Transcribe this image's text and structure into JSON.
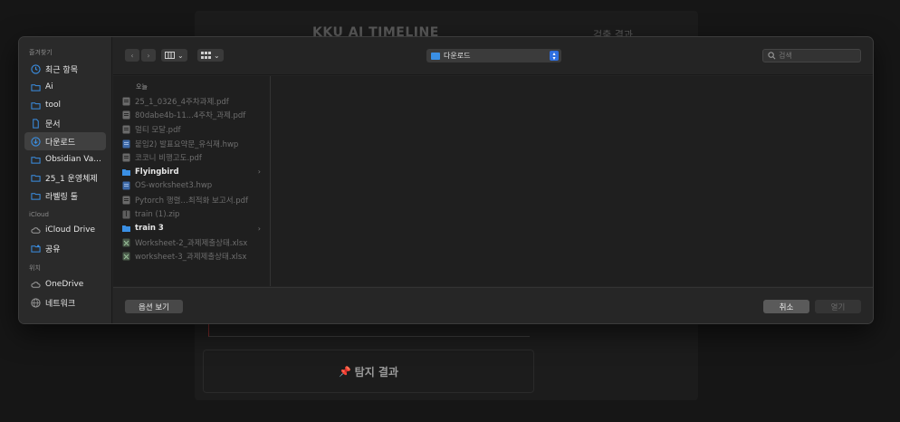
{
  "background": {
    "title": "KKU AI TIMELINE",
    "right_title": "검출 결과",
    "result_label": "탐지 결과",
    "result_icon": "pin-icon"
  },
  "sidebar": {
    "favorites_label": "즐겨찾기",
    "favorites": [
      {
        "label": "최근 항목",
        "icon": "clock-icon"
      },
      {
        "label": "Ai",
        "icon": "folder-icon"
      },
      {
        "label": "tool",
        "icon": "folder-icon"
      },
      {
        "label": "문서",
        "icon": "document-icon"
      },
      {
        "label": "다운로드",
        "icon": "download-icon",
        "active": true
      },
      {
        "label": "Obsidian Va...",
        "icon": "folder-icon"
      },
      {
        "label": "25_1 운영체제",
        "icon": "folder-icon"
      },
      {
        "label": "라벨링 툴",
        "icon": "folder-icon"
      }
    ],
    "icloud_label": "iCloud",
    "icloud": [
      {
        "label": "iCloud Drive",
        "icon": "cloud-icon"
      },
      {
        "label": "공유",
        "icon": "shared-folder-icon"
      }
    ],
    "locations_label": "위치",
    "locations": [
      {
        "label": "OneDrive",
        "icon": "cloud-icon"
      },
      {
        "label": "네트워크",
        "icon": "globe-icon"
      }
    ]
  },
  "toolbar": {
    "back": "‹",
    "forward": "›",
    "location": "다운로드",
    "search_placeholder": "검색"
  },
  "browser": {
    "column_header": "오늘",
    "files": [
      {
        "name": "25_1_0326_4주차과제.pdf",
        "type": "pdf",
        "folder": false
      },
      {
        "name": "80dabe4b-11...4주차_과제.pdf",
        "type": "pdf",
        "folder": false
      },
      {
        "name": "멀티 모달.pdf",
        "type": "pdf",
        "folder": false
      },
      {
        "name": "붙임2) 발표요약문_유식재.hwp",
        "type": "hwp",
        "folder": false
      },
      {
        "name": "코코니 비행고도.pdf",
        "type": "pdf",
        "folder": false
      },
      {
        "name": "Flyingbird",
        "type": "folder",
        "folder": true
      },
      {
        "name": "OS-worksheet3.hwp",
        "type": "hwp",
        "folder": false
      },
      {
        "name": "Pytorch 행렬…최적화 보고서.pdf",
        "type": "pdf",
        "folder": false
      },
      {
        "name": "train (1).zip",
        "type": "zip",
        "folder": false
      },
      {
        "name": "train 3",
        "type": "folder",
        "folder": true
      },
      {
        "name": "Worksheet-2_과제제출상태.xlsx",
        "type": "xlsx",
        "folder": false
      },
      {
        "name": "worksheet-3_과제제출상태.xlsx",
        "type": "xlsx",
        "folder": false
      }
    ]
  },
  "bottom": {
    "options_label": "옵션 보기",
    "cancel_label": "취소",
    "open_label": "열기"
  },
  "colors": {
    "accent": "#2f6fe0",
    "folder_blue": "#3a8fe4",
    "dialog_bg": "#242424"
  }
}
